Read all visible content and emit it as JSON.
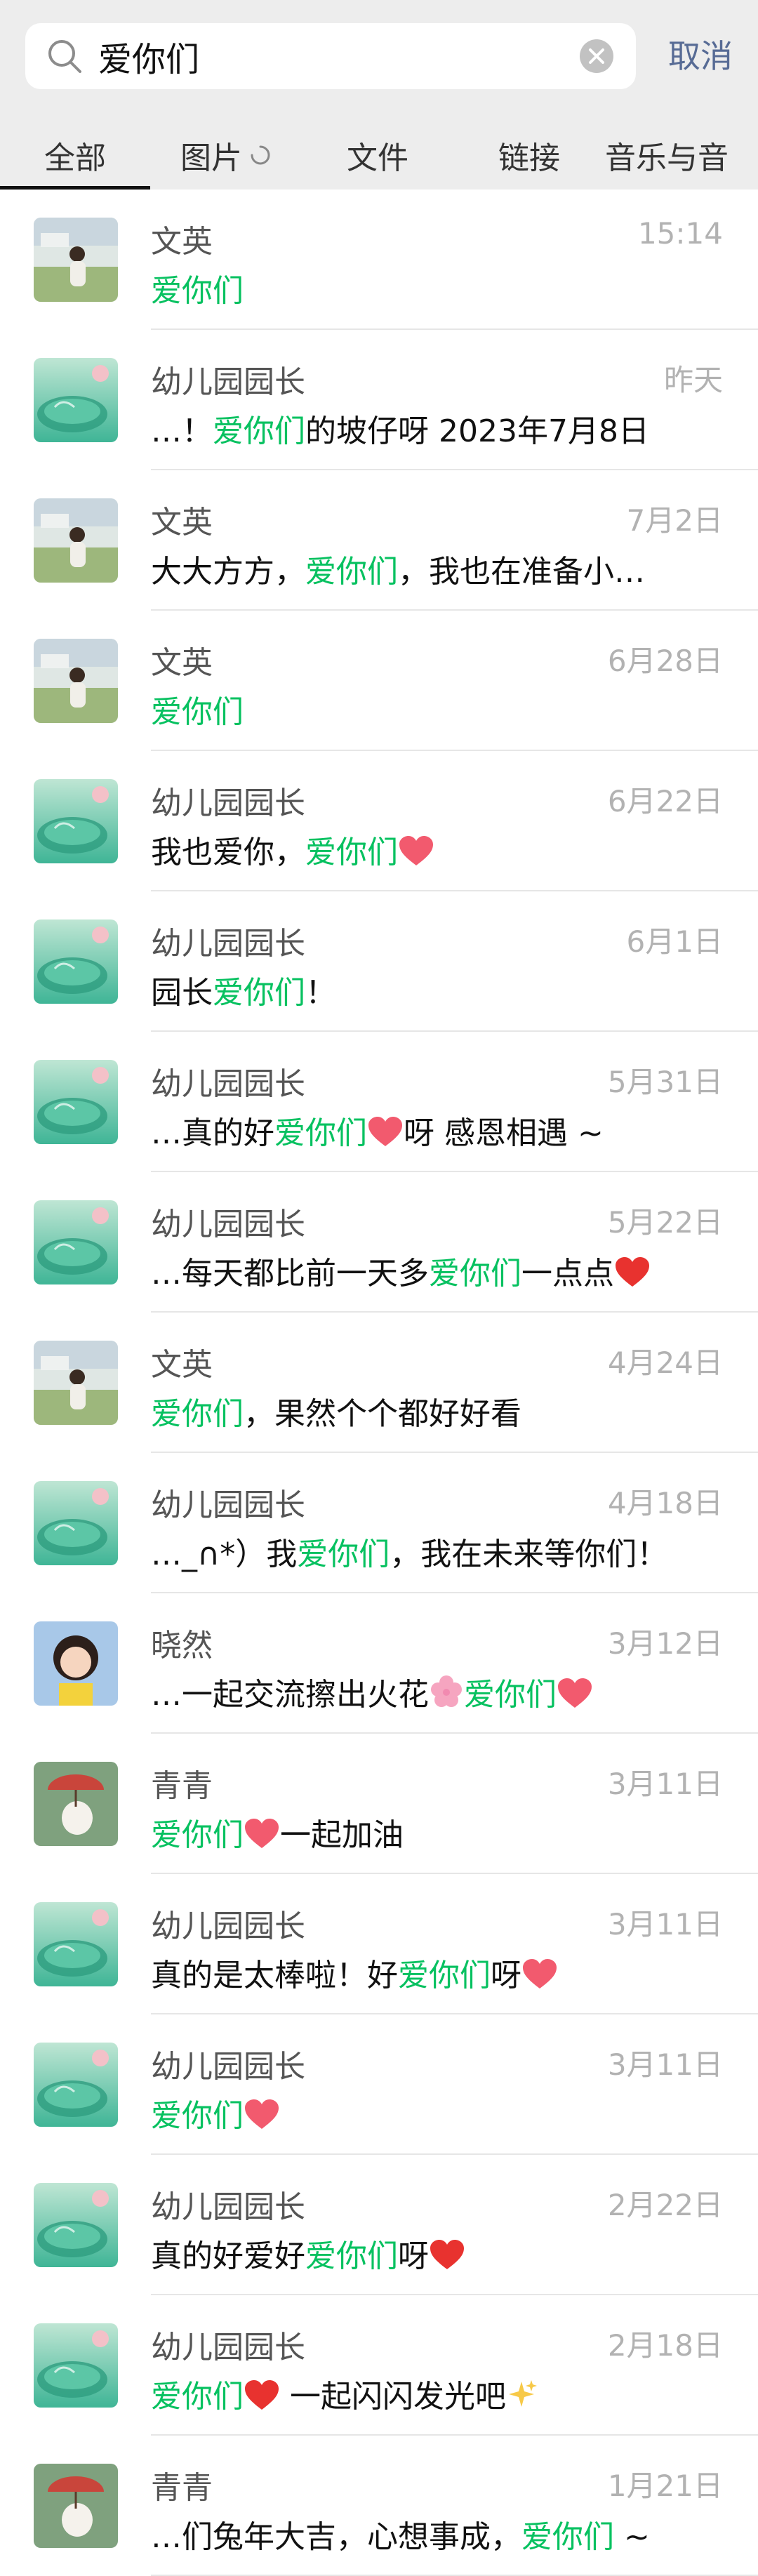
{
  "search": {
    "query": "爱你们",
    "cancel_label": "取消"
  },
  "tabs": [
    {
      "label": "全部"
    },
    {
      "label": "图片"
    },
    {
      "label": "文件"
    },
    {
      "label": "链接"
    },
    {
      "label": "音乐与音"
    }
  ],
  "results": [
    {
      "name": "文英",
      "time": "15:14",
      "pre": "",
      "hl": "爱你们",
      "post": ""
    },
    {
      "name": "幼儿园园长",
      "time": "昨天",
      "pre": "…！",
      "hl": "爱你们",
      "post": "的坡仔呀 2023年7月8日"
    },
    {
      "name": "文英",
      "time": "7月2日",
      "pre": "大大方方，",
      "hl": "爱你们",
      "post": "，我也在准备小…"
    },
    {
      "name": "文英",
      "time": "6月28日",
      "pre": "",
      "hl": "爱你们",
      "post": ""
    },
    {
      "name": "幼儿园园长",
      "time": "6月22日",
      "pre": "我也爱你，",
      "hl": "爱你们",
      "post": ""
    },
    {
      "name": "幼儿园园长",
      "time": "6月1日",
      "pre": "园长",
      "hl": "爱你们",
      "post": "！"
    },
    {
      "name": "幼儿园园长",
      "time": "5月31日",
      "pre": "…真的好",
      "hl": "爱你们",
      "post": "呀 感恩相遇 ~"
    },
    {
      "name": "幼儿园园长",
      "time": "5月22日",
      "pre": "…每天都比前一天多",
      "hl": "爱你们",
      "post": "一点点"
    },
    {
      "name": "文英",
      "time": "4月24日",
      "pre": "",
      "hl": "爱你们",
      "post": "，果然个个都好好看"
    },
    {
      "name": "幼儿园园长",
      "time": "4月18日",
      "pre": "…_∩*）我",
      "hl": "爱你们",
      "post": "，我在未来等你们！"
    },
    {
      "name": "晓然",
      "time": "3月12日",
      "pre": "…一起交流擦出火花",
      "hl": "爱你们",
      "post": ""
    },
    {
      "name": "青青",
      "time": "3月11日",
      "pre": "",
      "hl": "爱你们",
      "post": "一起加油"
    },
    {
      "name": "幼儿园园长",
      "time": "3月11日",
      "pre": "真的是太棒啦！好",
      "hl": "爱你们",
      "post": "呀"
    },
    {
      "name": "幼儿园园长",
      "time": "3月11日",
      "pre": "",
      "hl": "爱你们",
      "post": ""
    },
    {
      "name": "幼儿园园长",
      "time": "2月22日",
      "pre": "真的好爱好",
      "hl": "爱你们",
      "post": "呀"
    },
    {
      "name": "幼儿园园长",
      "time": "2月18日",
      "pre": "",
      "hl": "爱你们",
      "post": " 一起闪闪发光吧"
    },
    {
      "name": "青青",
      "time": "1月21日",
      "pre": "…们兔年大吉，心想事成，",
      "hl": "爱你们",
      "post": " ~"
    }
  ],
  "colors": {
    "highlight": "#07c160",
    "link": "#576b95",
    "time": "#b2b2b2",
    "header_bg": "#ededed"
  }
}
